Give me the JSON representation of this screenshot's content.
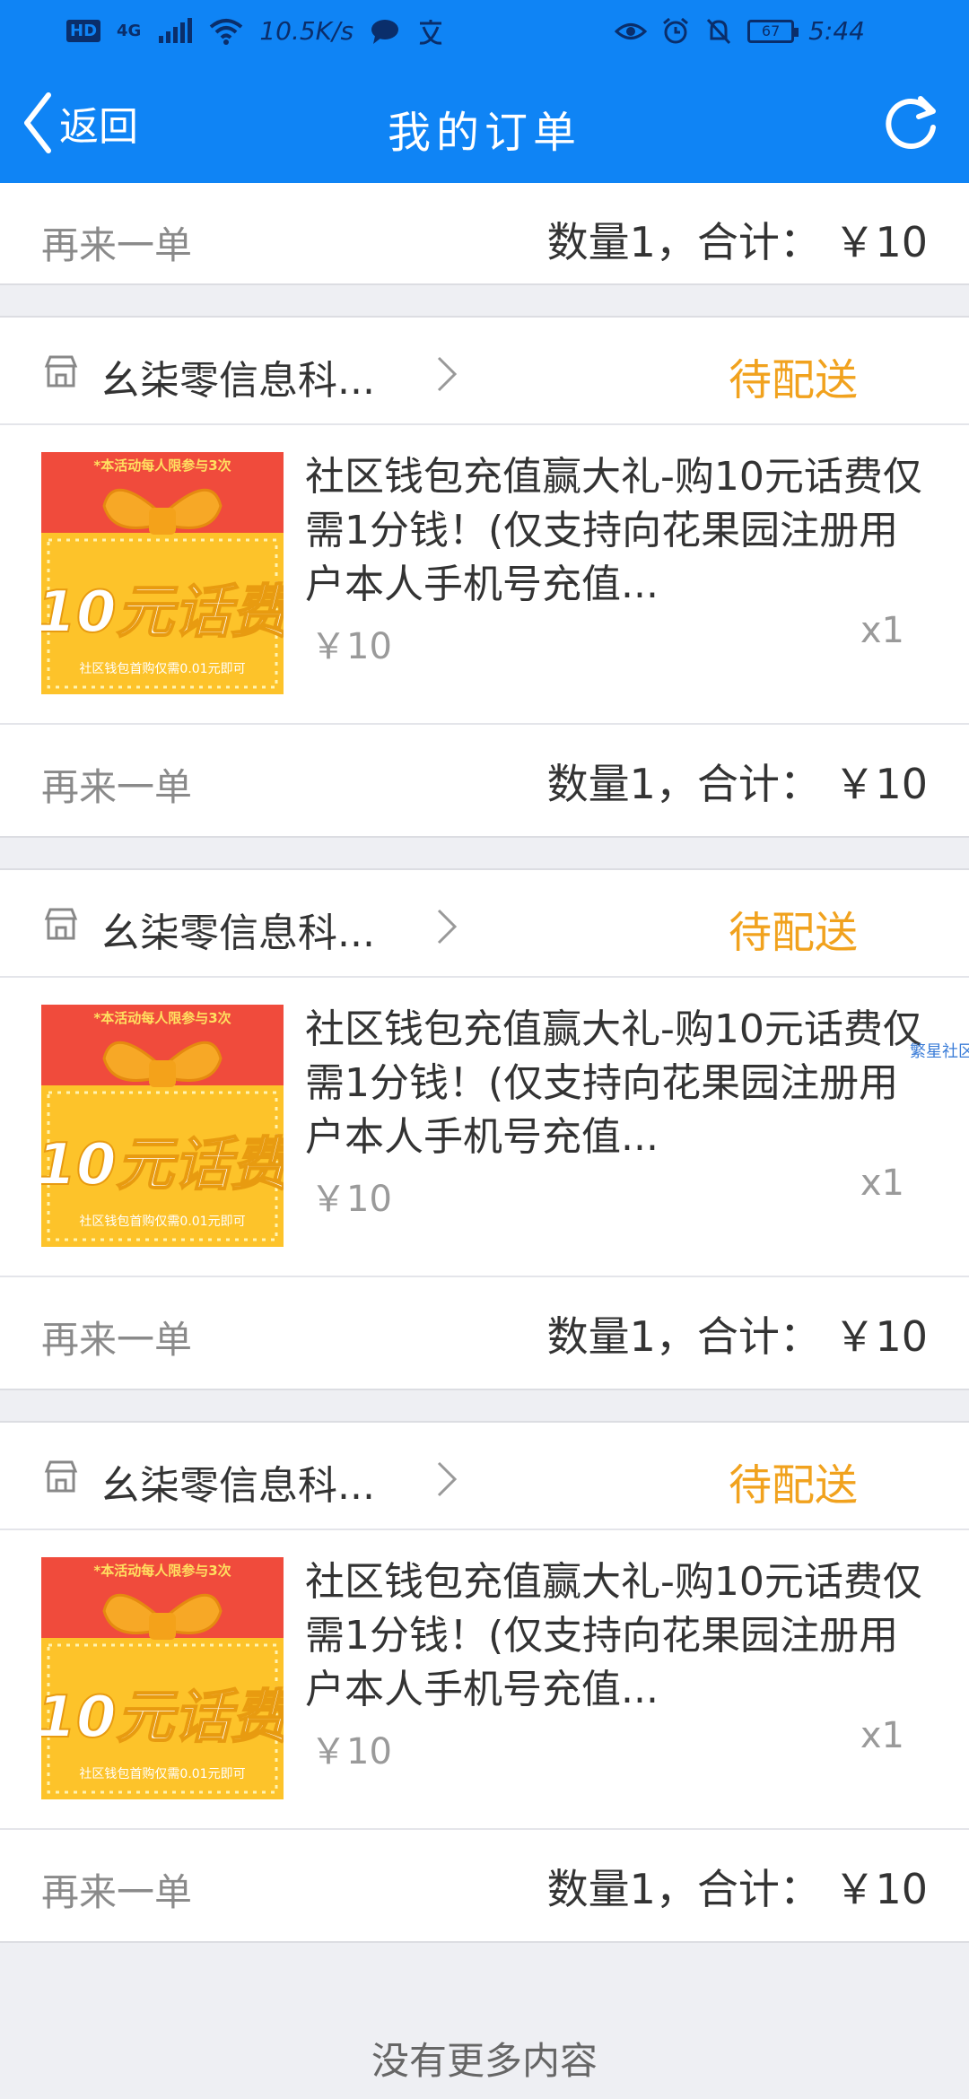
{
  "status_bar": {
    "hd": "HD",
    "network": "4G",
    "speed": "10.5K/s",
    "battery": "67",
    "time": "5:44"
  },
  "nav": {
    "back_label": "返回",
    "title": "我的订单"
  },
  "partial_order": {
    "reorder_label": "再来一单",
    "summary": "数量1，合计：  ￥10"
  },
  "orders": [
    {
      "store": "幺柒零信息科...",
      "status": "待配送",
      "thumb_top": "*本活动每人限参与3次",
      "thumb_big": "10元话费",
      "thumb_bottom": "社区钱包首购仅需0.01元即可",
      "title": "社区钱包充值赢大礼-购10元话费仅需1分钱！(仅支持向花果园注册用户本人手机号充值...",
      "price": "￥10",
      "qty": "x1",
      "reorder_label": "再来一单",
      "summary": "数量1，合计：  ￥10"
    },
    {
      "store": "幺柒零信息科...",
      "status": "待配送",
      "thumb_top": "*本活动每人限参与3次",
      "thumb_big": "10元话费",
      "thumb_bottom": "社区钱包首购仅需0.01元即可",
      "title": "社区钱包充值赢大礼-购10元话费仅需1分钱！(仅支持向花果园注册用户本人手机号充值...",
      "price": "￥10",
      "qty": "x1",
      "reorder_label": "再来一单",
      "summary": "数量1，合计：  ￥10"
    },
    {
      "store": "幺柒零信息科...",
      "status": "待配送",
      "thumb_top": "*本活动每人限参与3次",
      "thumb_big": "10元话费",
      "thumb_bottom": "社区钱包首购仅需0.01元即可",
      "title": "社区钱包充值赢大礼-购10元话费仅需1分钱！(仅支持向花果园注册用户本人手机号充值...",
      "price": "￥10",
      "qty": "x1",
      "reorder_label": "再来一单",
      "summary": "数量1，合计：  ￥10"
    }
  ],
  "edge_text": "繁星社区",
  "footer": {
    "no_more": "没有更多内容"
  },
  "colors": {
    "primary": "#0f84f5",
    "status": "#f1a21e",
    "background": "#eeeff3"
  }
}
